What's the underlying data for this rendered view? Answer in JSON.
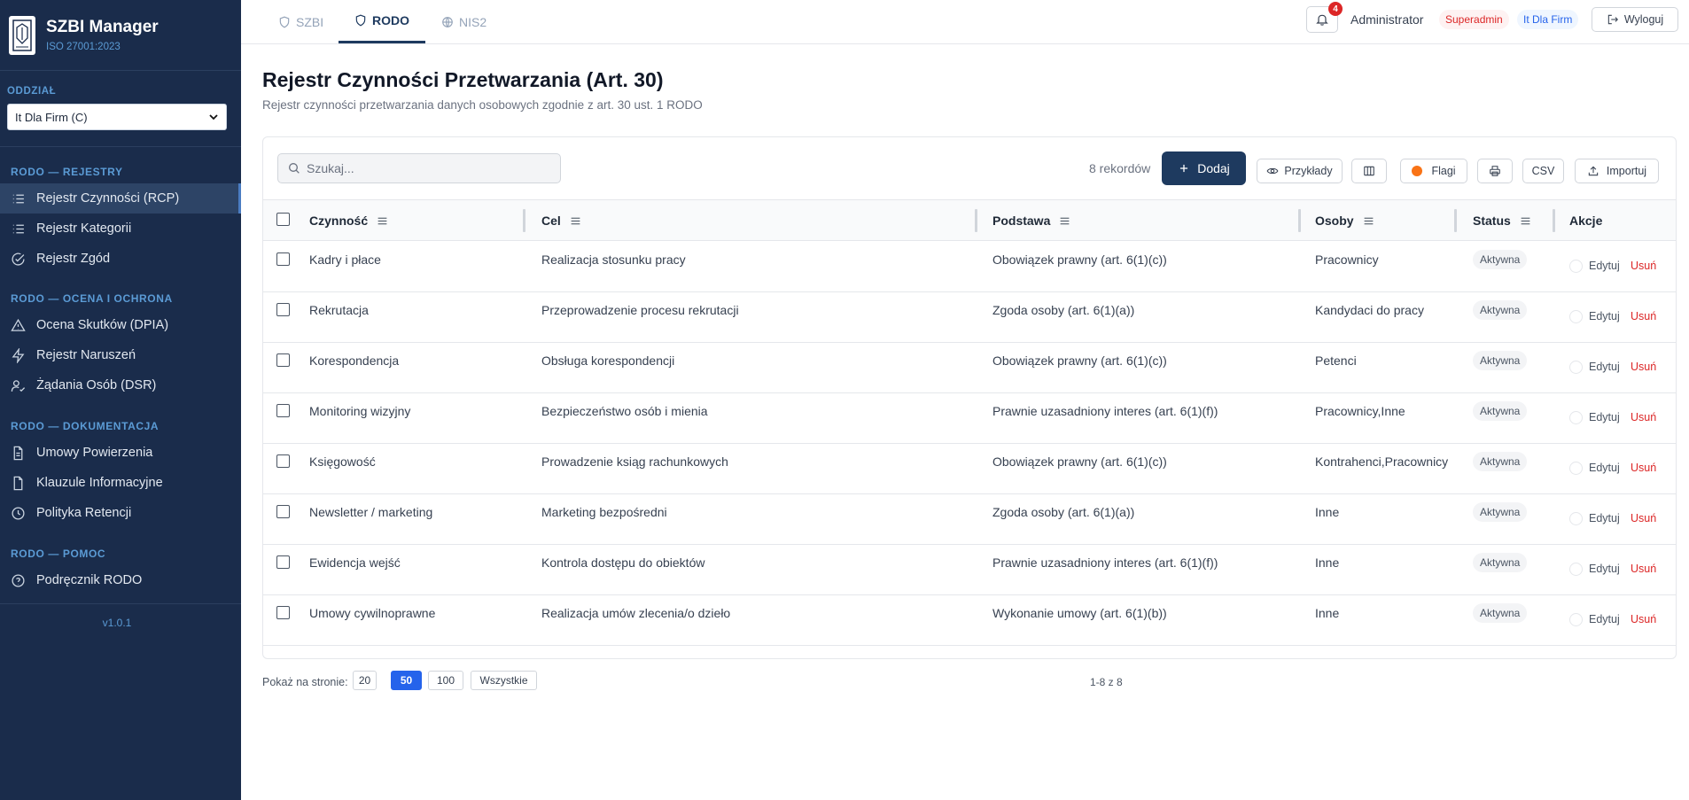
{
  "app": {
    "title": "SZBI Manager",
    "subtitle": "ISO 27001:2023"
  },
  "sidebar": {
    "oddzial_label": "ODDZIAŁ",
    "oddzial_value": "It Dla Firm (C)",
    "sections": [
      {
        "title": "RODO — REJESTRY",
        "items": [
          {
            "label": "Rejestr Czynności (RCP)",
            "icon": "list-icon",
            "active": true
          },
          {
            "label": "Rejestr Kategorii",
            "icon": "list-icon"
          },
          {
            "label": "Rejestr Zgód",
            "icon": "check-circle-icon"
          }
        ]
      },
      {
        "title": "RODO — OCENA I OCHRONA",
        "items": [
          {
            "label": "Ocena Skutków (DPIA)",
            "icon": "warning-triangle-icon"
          },
          {
            "label": "Rejestr Naruszeń",
            "icon": "lightning-icon"
          },
          {
            "label": "Żądania Osób (DSR)",
            "icon": "user-check-icon"
          }
        ]
      },
      {
        "title": "RODO — DOKUMENTACJA",
        "items": [
          {
            "label": "Umowy Powierzenia",
            "icon": "document-text-icon"
          },
          {
            "label": "Klauzule Informacyjne",
            "icon": "document-icon"
          },
          {
            "label": "Polityka Retencji",
            "icon": "clock-icon"
          }
        ]
      },
      {
        "title": "RODO — POMOC",
        "items": [
          {
            "label": "Podręcznik RODO",
            "icon": "help-circle-icon"
          }
        ]
      }
    ],
    "version": "v1.0.1"
  },
  "topbar": {
    "tabs": [
      {
        "label": "SZBI",
        "icon": "shield-icon"
      },
      {
        "label": "RODO",
        "icon": "shield-icon",
        "active": true
      },
      {
        "label": "NIS2",
        "icon": "globe-icon"
      }
    ],
    "notification_count": "4",
    "user_name": "Administrator",
    "role_badge": "Superadmin",
    "org_badge": "It Dla Firm",
    "logout_label": "Wyloguj"
  },
  "page": {
    "title": "Rejestr Czynności Przetwarzania (Art. 30)",
    "subtitle": "Rejestr czynności przetwarzania danych osobowych zgodnie z art. 30 ust. 1 RODO"
  },
  "toolbar": {
    "search_placeholder": "Szukaj...",
    "record_count": "8 rekordów",
    "add_label": "Dodaj",
    "examples_label": "Przykłady",
    "flags_label": "Flagi",
    "csv_label": "CSV",
    "import_label": "Importuj"
  },
  "table": {
    "headers": {
      "activity": "Czynność",
      "purpose": "Cel",
      "basis": "Podstawa",
      "persons": "Osoby",
      "status": "Status",
      "actions": "Akcje"
    },
    "edit_label": "Edytuj",
    "delete_label": "Usuń",
    "rows": [
      {
        "activity": "Kadry i płace",
        "purpose": "Realizacja stosunku pracy",
        "basis": "Obowiązek prawny (art. 6(1)(c))",
        "persons": "Pracownicy",
        "status": "Aktywna"
      },
      {
        "activity": "Rekrutacja",
        "purpose": "Przeprowadzenie procesu rekrutacji",
        "basis": "Zgoda osoby (art. 6(1)(a))",
        "persons": "Kandydaci do pracy",
        "status": "Aktywna"
      },
      {
        "activity": "Korespondencja",
        "purpose": "Obsługa korespondencji",
        "basis": "Obowiązek prawny (art. 6(1)(c))",
        "persons": "Petenci",
        "status": "Aktywna"
      },
      {
        "activity": "Monitoring wizyjny",
        "purpose": "Bezpieczeństwo osób i mienia",
        "basis": "Prawnie uzasadniony interes (art. 6(1)(f))",
        "persons": "Pracownicy,Inne",
        "status": "Aktywna"
      },
      {
        "activity": "Księgowość",
        "purpose": "Prowadzenie ksiąg rachunkowych",
        "basis": "Obowiązek prawny (art. 6(1)(c))",
        "persons": "Kontrahenci,Pracownicy",
        "status": "Aktywna"
      },
      {
        "activity": "Newsletter / marketing",
        "purpose": "Marketing bezpośredni",
        "basis": "Zgoda osoby (art. 6(1)(a))",
        "persons": "Inne",
        "status": "Aktywna"
      },
      {
        "activity": "Ewidencja wejść",
        "purpose": "Kontrola dostępu do obiektów",
        "basis": "Prawnie uzasadniony interes (art. 6(1)(f))",
        "persons": "Inne",
        "status": "Aktywna"
      },
      {
        "activity": "Umowy cywilnoprawne",
        "purpose": "Realizacja umów zlecenia/o dzieło",
        "basis": "Wykonanie umowy (art. 6(1)(b))",
        "persons": "Inne",
        "status": "Aktywna"
      }
    ]
  },
  "pagination": {
    "label": "Pokaż na stronie:",
    "options": [
      "20",
      "50",
      "100",
      "Wszystkie"
    ],
    "selected": "50",
    "range": "1-8 z 8"
  },
  "colors": {
    "sidebar_bg": "#1a2c4b",
    "primary": "#1e3a5f",
    "accent_blue": "#5b9bd5",
    "danger": "#dc2626",
    "flag_orange": "#f97316"
  }
}
